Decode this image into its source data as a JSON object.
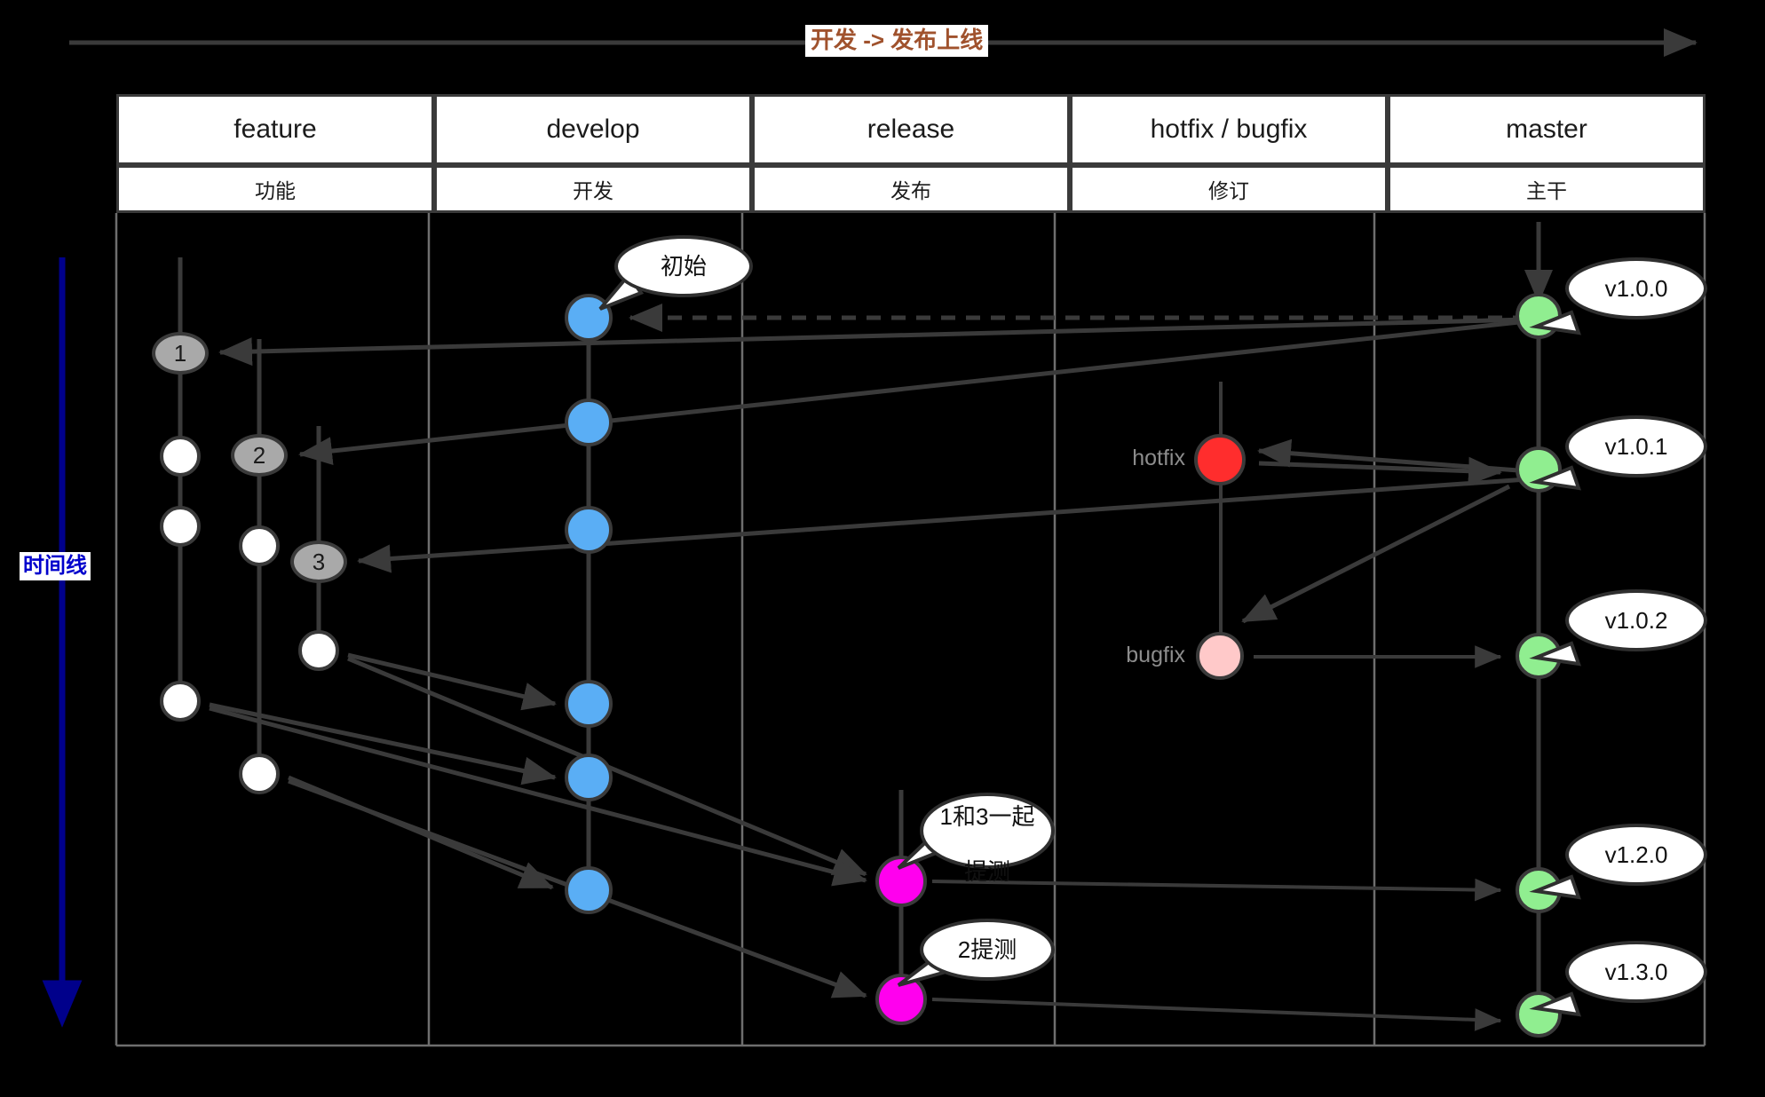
{
  "diagram": {
    "flow_title": "开发 -> 发布上线",
    "timeline_label": "时间线"
  },
  "columns": [
    {
      "key": "feature",
      "en": "feature",
      "cn": "功能"
    },
    {
      "key": "develop",
      "en": "develop",
      "cn": "开发"
    },
    {
      "key": "release",
      "en": "release",
      "cn": "发布"
    },
    {
      "key": "hotfix",
      "en": "hotfix / bugfix",
      "cn": "修订"
    },
    {
      "key": "master",
      "en": "master",
      "cn": "主干"
    }
  ],
  "feature_branches": {
    "branch1_label": "1",
    "branch2_label": "2",
    "branch3_label": "3"
  },
  "side_labels": {
    "hotfix": "hotfix",
    "bugfix": "bugfix"
  },
  "callouts": {
    "init": "初始",
    "release_1": "1和3一起\n提测",
    "release_1_line1": "1和3一起",
    "release_1_line2": "提测",
    "release_2": "2提测"
  },
  "master_tags": [
    "v1.0.0",
    "v1.0.1",
    "v1.0.2",
    "v1.2.0",
    "v1.3.0"
  ],
  "colors": {
    "background": "#000000",
    "stroke": "#3a3a3a",
    "title": "#A0522D",
    "timeline": "#0000CC",
    "develop_node": "#5AAEF5",
    "feature_branch_node": "#A9A9A9",
    "feature_commit_node": "#FFFFFF",
    "release_node": "#FF00EE",
    "hotfix_node": "#FF2D2D",
    "bugfix_node": "#FFC9C9",
    "master_node": "#90EE90",
    "header_bg": "#FFFFFF",
    "side_label": "#8C8C8C"
  }
}
